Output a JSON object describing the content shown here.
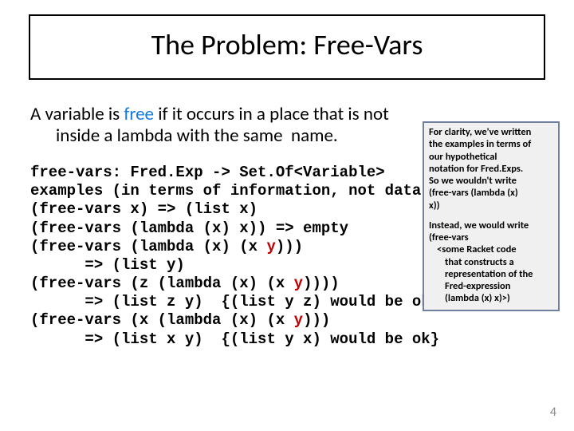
{
  "title": "The Problem: Free-Vars",
  "intro": {
    "line1_pre": "A variable is ",
    "free_word": "free",
    "line1_post": " if it occurs in a place that is not",
    "line2_a": "inside a lambda with the same",
    "line2_b": "name."
  },
  "code": {
    "l1": "free-vars: Fred.Exp -> Set.Of<Variable>",
    "l2": "examples (in terms of information, not data):",
    "l3": "(free-vars x) => (list x)",
    "l4": "(free-vars (lambda (x) x)) => empty",
    "l5a": "(free-vars (lambda (x) (x ",
    "l5y": "y",
    "l5b": ")))",
    "l6": "      => (list y)",
    "l7a": "(free-vars (z (lambda (x) (x ",
    "l7y": "y",
    "l7b": "))))",
    "l8": "      => (list z y)  {(list y z) would be ok}",
    "l9a": "(free-vars (x (lambda (x) (x ",
    "l9y": "y",
    "l9b": ")))",
    "l10": "      => (list x y)  {(list y x) would be ok}"
  },
  "note": {
    "p1a": "For clarity, we've written",
    "p1b": "the examples in terms of",
    "p1c": "our hypothetical",
    "p1d": "notation for Fred.Exps.",
    "p1e": "So we wouldn't write",
    "p1f": "(free-vars (lambda (x)",
    "p1g": "x))",
    "p2a": "Instead, we would write",
    "p2b": "(free-vars",
    "p2c": "<some Racket code",
    "p2d": "that constructs a",
    "p2e": "representation of the",
    "p2f": "Fred-expression",
    "p2g": "(lambda (x) x)>)"
  },
  "page": "4"
}
